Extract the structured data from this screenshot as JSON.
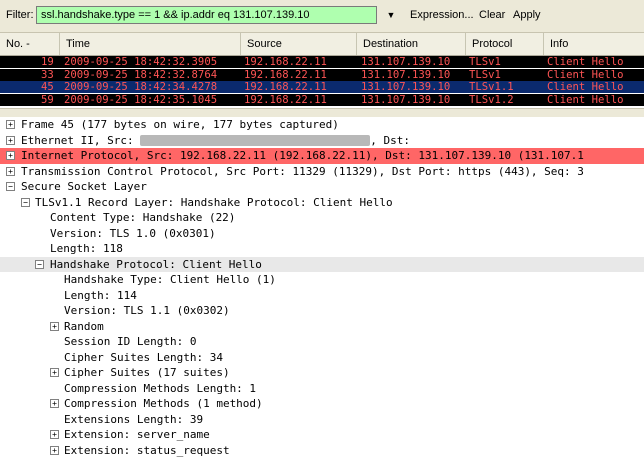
{
  "filter": {
    "label": "Filter:",
    "value": "ssl.handshake.type == 1 && ip.addr eq 131.107.139.10",
    "buttons": {
      "expression": "Expression...",
      "clear": "Clear",
      "apply": "Apply"
    }
  },
  "packet_list": {
    "columns": [
      "No. -",
      "Time",
      "Source",
      "Destination",
      "Protocol",
      "Info"
    ],
    "rows": [
      {
        "no": "19",
        "time": "2009-09-25 18:42:32.3905",
        "source": "192.168.22.11",
        "destination": "131.107.139.10",
        "protocol": "TLSv1",
        "info": "Client Hello"
      },
      {
        "no": "33",
        "time": "2009-09-25 18:42:32.8764",
        "source": "192.168.22.11",
        "destination": "131.107.139.10",
        "protocol": "TLSv1",
        "info": "Client Hello"
      },
      {
        "no": "45",
        "time": "2009-09-25 18:42:34.4278",
        "source": "192.168.22.11",
        "destination": "131.107.139.10",
        "protocol": "TLSv1.1",
        "info": "Client Hello"
      },
      {
        "no": "59",
        "time": "2009-09-25 18:42:35.1045",
        "source": "192.168.22.11",
        "destination": "131.107.139.10",
        "protocol": "TLSv1.2",
        "info": "Client Hello"
      }
    ],
    "selected_index": 2
  },
  "details": {
    "frame": "Frame 45 (177 bytes on wire, 177 bytes captured)",
    "ethernet_src": "Ethernet II, Src:",
    "ethernet_dst": ", Dst:",
    "ip": "Internet Protocol, Src: 192.168.22.11 (192.168.22.11), Dst: 131.107.139.10 (131.107.1",
    "tcp": "Transmission Control Protocol, Src Port: 11329 (11329), Dst Port: https (443), Seq: 3",
    "ssl": "Secure Socket Layer",
    "record": "TLSv1.1 Record Layer: Handshake Protocol: Client Hello",
    "content_type": "Content Type: Handshake (22)",
    "version": "Version: TLS 1.0 (0x0301)",
    "length": "Length: 118",
    "handshake": "Handshake Protocol: Client Hello",
    "hs_type": "Handshake Type: Client Hello (1)",
    "hs_length": "Length: 114",
    "hs_version": "Version: TLS 1.1 (0x0302)",
    "random": "Random",
    "session_id": "Session ID Length: 0",
    "cipher_len": "Cipher Suites Length: 34",
    "cipher_suites": "Cipher Suites (17 suites)",
    "comp_len": "Compression Methods Length: 1",
    "comp_methods": "Compression Methods (1 method)",
    "ext_len": "Extensions Length: 39",
    "ext_server_name": "Extension: server_name",
    "ext_status": "Extension: status_request"
  },
  "colors": {
    "filter_ok": "#afffaf",
    "row_bg": "#000000",
    "row_fg": "#ff5555",
    "selected_bg": "#0b2a6e",
    "ip_highlight": "#ff6666"
  }
}
